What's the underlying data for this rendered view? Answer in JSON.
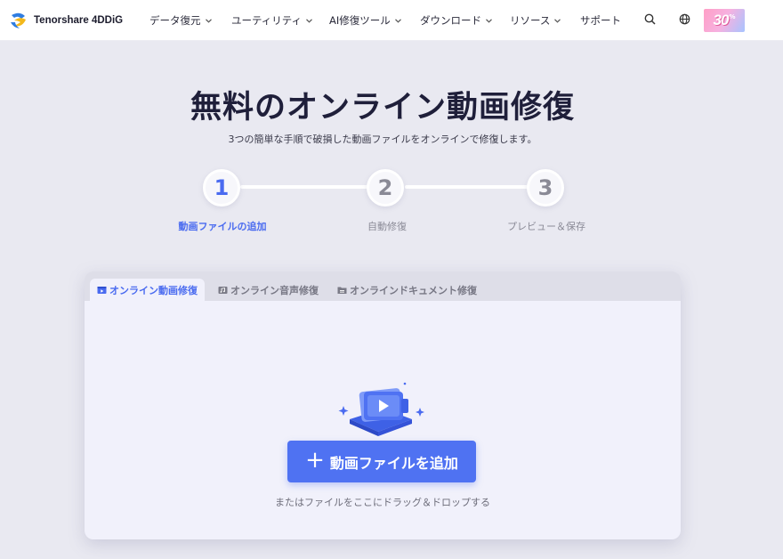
{
  "header": {
    "brand": "Tenorshare 4DDiG",
    "nav": [
      {
        "label": "データ復元"
      },
      {
        "label": "ユーティリティ"
      },
      {
        "label": "AI修復ツール"
      },
      {
        "label": "ダウンロード"
      },
      {
        "label": "リソース"
      },
      {
        "label": "サポート"
      }
    ],
    "promo": {
      "number": "30",
      "suffix": "%"
    },
    "icons": [
      "search-icon",
      "globe-icon"
    ]
  },
  "hero": {
    "title": "無料のオンライン動画修復",
    "subtitle": "3つの簡単な手順で破損した動画ファイルをオンラインで修復します。"
  },
  "steps": [
    {
      "number": "1",
      "label": "動画ファイルの追加",
      "active": true
    },
    {
      "number": "2",
      "label": "自動修復",
      "active": false
    },
    {
      "number": "3",
      "label": "プレビュー＆保存",
      "active": false
    }
  ],
  "tabs": [
    {
      "label": "オンライン動画修復",
      "icon": "video-icon",
      "active": true
    },
    {
      "label": "オンライン音声修復",
      "icon": "audio-icon",
      "active": false
    },
    {
      "label": "オンラインドキュメント修復",
      "icon": "document-icon",
      "active": false
    }
  ],
  "upload": {
    "button_label": "動画ファイルを追加",
    "hint": "またはファイルをここにドラッグ＆ドロップする"
  },
  "colors": {
    "accent": "#4a6bf0",
    "button": "#4f72f2",
    "background": "#e9e9f1"
  }
}
